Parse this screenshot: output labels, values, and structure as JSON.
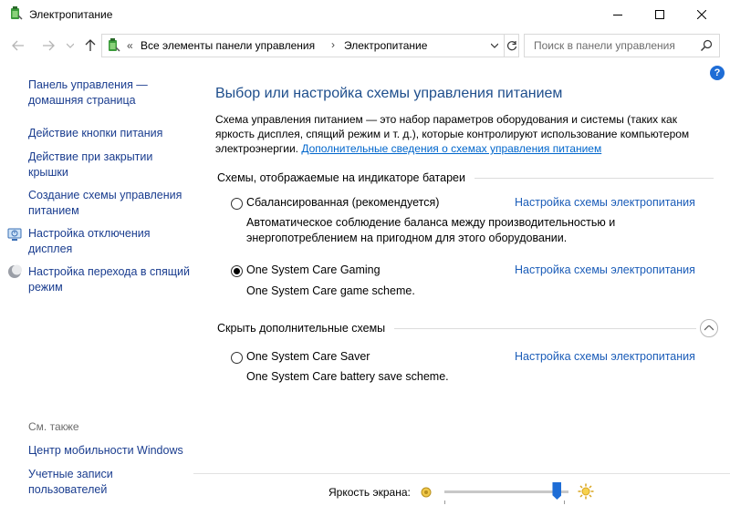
{
  "window": {
    "title": "Электропитание",
    "minimize_icon": "minimize-icon",
    "maximize_icon": "maximize-icon",
    "close_icon": "close-icon"
  },
  "address": {
    "chevron": "«",
    "crumbs": [
      "Все элементы панели управления",
      "Электропитание"
    ],
    "search_placeholder": "Поиск в панели управления"
  },
  "help_label": "?",
  "sidebar": {
    "links": [
      {
        "label": "Панель управления — домашняя страница"
      },
      {
        "label": "Действие кнопки питания"
      },
      {
        "label": "Действие при закрытии крышки"
      },
      {
        "label": "Создание схемы управления питанием"
      },
      {
        "label": "Настройка отключения дисплея",
        "icon": "display-power-icon"
      },
      {
        "label": "Настройка перехода в спящий режим",
        "icon": "moon-sleep-icon"
      }
    ],
    "see_also": "См. также",
    "see_also_links": [
      "Центр мобильности Windows",
      "Учетные записи пользователей"
    ]
  },
  "main": {
    "title": "Выбор или настройка схемы управления питанием",
    "description": "Схема управления питанием — это набор параметров оборудования и системы (таких как яркость дисплея, спящий режим и т. д.), которые контролируют использование компьютером электроэнергии.",
    "description_link": "Дополнительные сведения о схемах управления питанием",
    "section_shown": "Схемы, отображаемые на индикаторе батареи",
    "section_hidden": "Скрыть дополнительные схемы",
    "plan_link_label": "Настройка схемы электропитания",
    "plans": [
      {
        "name": "Сбалансированная (рекомендуется)",
        "desc": "Автоматическое соблюдение баланса между производительностью и энергопотреблением на пригодном для этого оборудовании.",
        "selected": false
      },
      {
        "name": "One System Care Gaming",
        "desc": "One System Care game scheme.",
        "selected": true
      },
      {
        "name": "One System Care Saver",
        "desc": "One System Care battery save scheme.",
        "selected": false
      }
    ]
  },
  "brightness": {
    "label": "Яркость экрана:",
    "value_fraction": 0.93
  },
  "colors": {
    "link": "#1a5cb8",
    "title": "#1e4e8c",
    "accent": "#1e6dd6"
  }
}
